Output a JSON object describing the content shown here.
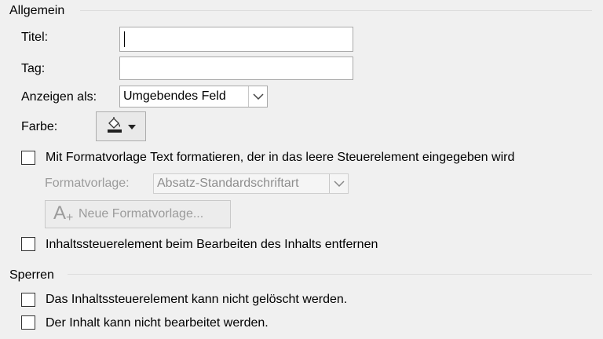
{
  "general": {
    "title": "Allgemein",
    "title_label": "Titel:",
    "title_value": "",
    "tag_label": "Tag:",
    "tag_value": "",
    "display_label": "Anzeigen als:",
    "display_value": "Umgebendes Feld",
    "color_label": "Farbe:",
    "format_checkbox_label": "Mit Formatvorlage Text formatieren, der in das leere Steuerelement eingegeben wird",
    "format_checked": false,
    "style_label": "Formatvorlage:",
    "style_value": "Absatz-Standardschriftart",
    "new_style_button": "Neue Formatvorlage...",
    "remove_checkbox_label": "Inhaltssteuerelement beim Bearbeiten des Inhalts entfernen",
    "remove_checked": false
  },
  "lock": {
    "title": "Sperren",
    "no_delete_label": "Das Inhaltssteuerelement kann nicht gelöscht werden.",
    "no_delete_checked": false,
    "no_edit_label": "Der Inhalt kann nicht bearbeitet werden.",
    "no_edit_checked": false
  },
  "icons": {
    "paint_bucket": "paint-bucket-icon",
    "dropdown": "chevron-down-icon",
    "new_style": "new-style-icon"
  },
  "colors": {
    "background": "#f0f0f0",
    "disabled_text": "#9b9b9b",
    "paint_bucket_stripe": "#1f1f1f"
  }
}
